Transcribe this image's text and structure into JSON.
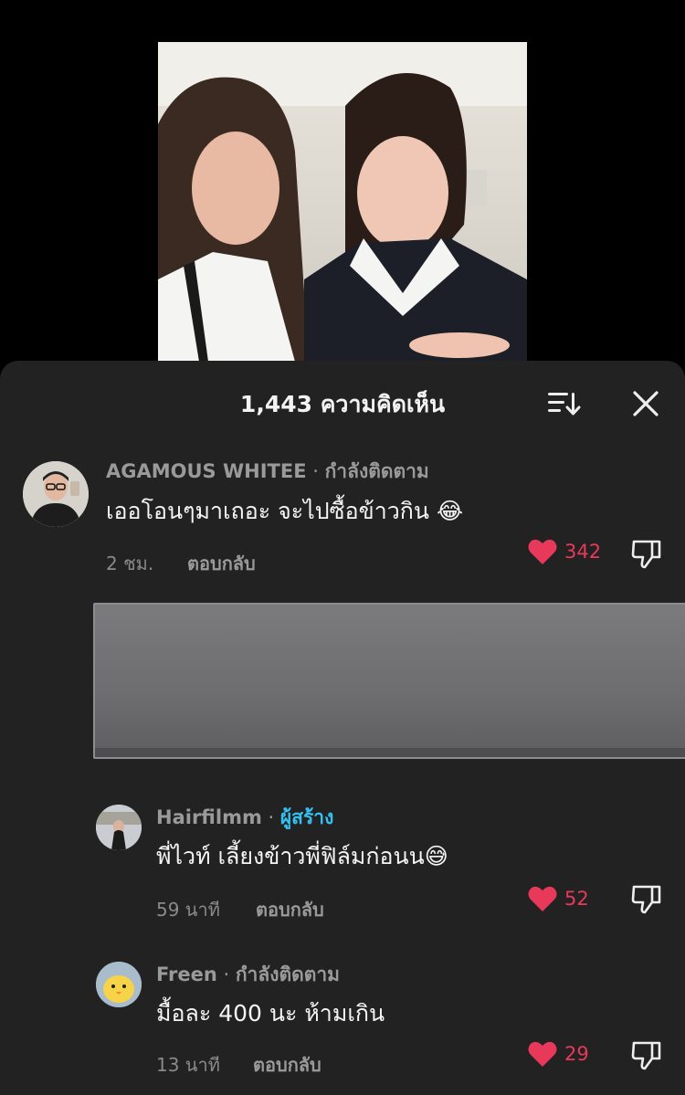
{
  "sheet": {
    "title": "1,443 ความคิดเห็น"
  },
  "comments": [
    {
      "username": "AGAMOUS WHITEE",
      "status": "กำลังติดตาม",
      "text": "เออโอนๆมาเถอะ จะไปซื้อข้าวกิน 😂",
      "time": "2 ชม.",
      "reply_label": "ตอบกลับ",
      "likes": "342"
    },
    {
      "username": "Hairfilmm",
      "status": "ผู้สร้าง",
      "text": "พี่ไวท์ เลี้ยงข้าวพี่ฟิล์มก่อนน😅",
      "time": "59 นาที",
      "reply_label": "ตอบกลับ",
      "likes": "52"
    },
    {
      "username": "Freen",
      "status": "กำลังติดตาม",
      "text": "มื้อละ 400 นะ ห้ามเกิน",
      "time": "13 นาที",
      "reply_label": "ตอบกลับ",
      "likes": "29"
    }
  ],
  "colors": {
    "like": "#e8395a",
    "creator": "#36c0f0",
    "sheet_bg": "#222222"
  }
}
